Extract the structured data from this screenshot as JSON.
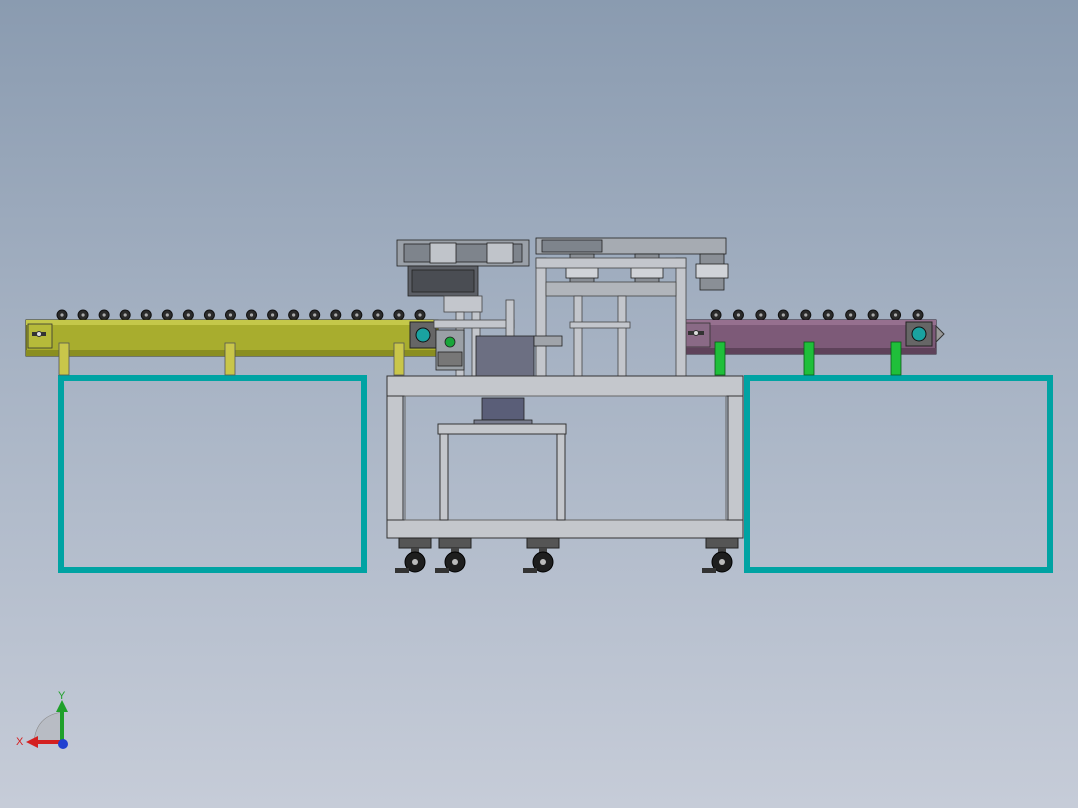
{
  "viewport": {
    "background_top": "#8a9bb0",
    "background_bottom": "#c6ccd8"
  },
  "model": {
    "left_conveyor": {
      "color": "#a8ad2e",
      "roller_count": 18,
      "leg_color": "#c9c64a"
    },
    "right_conveyor": {
      "color": "#7d5a78",
      "roller_count": 10,
      "leg_color": "#1fbf3a"
    },
    "base_frames": {
      "color": "#00a3a3"
    },
    "center_machine": {
      "frame_color": "#b9bcc2",
      "caster_count": 4
    }
  },
  "triad": {
    "x_label": "X",
    "y_label": "Y",
    "x_color": "#d42020",
    "y_color": "#1fa02a",
    "z_color": "#2040d0"
  }
}
